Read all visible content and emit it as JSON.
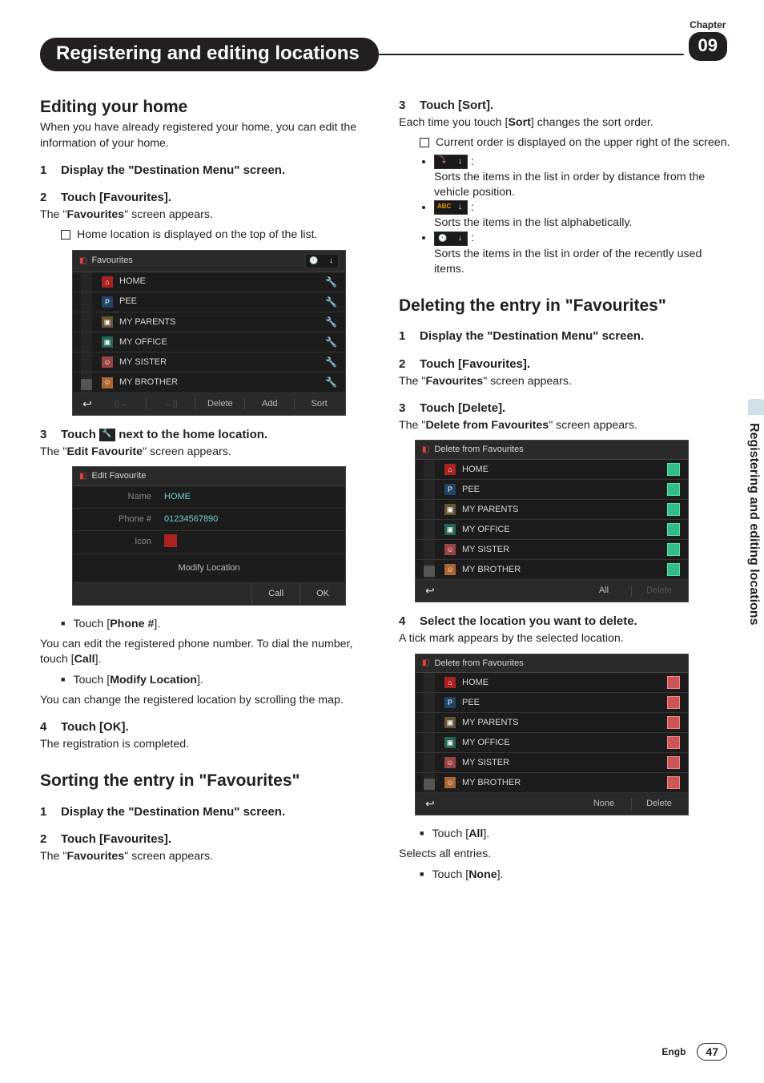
{
  "meta": {
    "chapter_label": "Chapter",
    "chapter_number": "09",
    "lang_code": "Engb",
    "page_number": "47",
    "side_tab": "Registering and editing locations"
  },
  "title": "Registering and editing locations",
  "left": {
    "h_edit_home": "Editing your home",
    "p_edit_home_intro": "When you have already registered your home, you can edit the information of your home.",
    "step1": "Display the \"Destination Menu\" screen.",
    "step2": "Touch [Favourites].",
    "p_fav_appears1": "The \"",
    "p_fav_appears_bold": "Favourites",
    "p_fav_appears2": "\" screen appears.",
    "note_home_top": "Home location is displayed on the top of the list.",
    "step3_pre": "Touch ",
    "step3_post": " next to the home location.",
    "p_edit_fav_appears1": "The \"",
    "p_edit_fav_appears_bold": "Edit Favourite",
    "p_edit_fav_appears2": "\" screen appears.",
    "bul_phone_pre": "Touch [",
    "bul_phone_bold": "Phone #",
    "bul_phone_post": "].",
    "p_phone_desc1": "You can edit the registered phone number. To dial the number, touch [",
    "p_phone_desc_bold": "Call",
    "p_phone_desc2": "].",
    "bul_modloc_pre": "Touch [",
    "bul_modloc_bold": "Modify Location",
    "bul_modloc_post": "].",
    "p_modloc_desc": "You can change the registered location by scrolling the map.",
    "step4": "Touch [OK].",
    "p_reg_complete": "The registration is completed.",
    "h_sort": "Sorting the entry in \"Favourites\"",
    "sort_step1": "Display the \"Destination Menu\" screen.",
    "sort_step2": "Touch [Favourites].",
    "p_sort_fav_appears1": "The \"",
    "p_sort_fav_appears_bold": "Favourites",
    "p_sort_fav_appears2": "\" screen appears."
  },
  "right": {
    "sort_step3": "Touch [Sort].",
    "p_sort_desc1": "Each time you touch [",
    "p_sort_desc_bold": "Sort",
    "p_sort_desc2": "] changes the sort order.",
    "note_current_order": "Current order is displayed on the upper right of the screen.",
    "sort_dist": "Sorts the items in the list in order by distance from the vehicle position.",
    "sort_abc": "Sorts the items in the list alphabetically.",
    "sort_recent": "Sorts the items in the list in order of the recently used items.",
    "h_delete": "Deleting the entry in \"Favourites\"",
    "del_step1": "Display the \"Destination Menu\" screen.",
    "del_step2": "Touch [Favourites].",
    "p_del_fav_appears1": "The \"",
    "p_del_fav_appears_bold": "Favourites",
    "p_del_fav_appears2": "\" screen appears.",
    "del_step3": "Touch [Delete].",
    "p_del_screen1": "The \"",
    "p_del_screen_bold": "Delete from Favourites",
    "p_del_screen2": "\" screen appears.",
    "del_step4": "Select the location you want to delete.",
    "p_tick": "A tick mark appears by the selected location.",
    "bul_all_pre": "Touch [",
    "bul_all_bold": "All",
    "bul_all_post": "].",
    "p_all_desc": "Selects all entries.",
    "bul_none_pre": "Touch [",
    "bul_none_bold": "None",
    "bul_none_post": "]."
  },
  "fav_shot": {
    "title": "Favourites",
    "items": [
      "HOME",
      "PEE",
      "MY PARENTS",
      "MY OFFICE",
      "MY SISTER",
      "MY BROTHER"
    ],
    "bottom": {
      "delete": "Delete",
      "add": "Add",
      "sort": "Sort"
    }
  },
  "edit_shot": {
    "title": "Edit Favourite",
    "name_label": "Name",
    "name_val": "HOME",
    "phone_label": "Phone #",
    "phone_val": "01234567890",
    "icon_label": "Icon",
    "modify": "Modify Location",
    "call": "Call",
    "ok": "OK"
  },
  "del_shot1": {
    "title": "Delete from Favourites",
    "items": [
      "HOME",
      "PEE",
      "MY PARENTS",
      "MY OFFICE",
      "MY SISTER",
      "MY BROTHER"
    ],
    "bottom": {
      "all": "All",
      "delete": "Delete"
    }
  },
  "del_shot2": {
    "title": "Delete from Favourites",
    "items": [
      "HOME",
      "PEE",
      "MY PARENTS",
      "MY OFFICE",
      "MY SISTER",
      "MY BROTHER"
    ],
    "bottom": {
      "none": "None",
      "delete": "Delete"
    }
  }
}
